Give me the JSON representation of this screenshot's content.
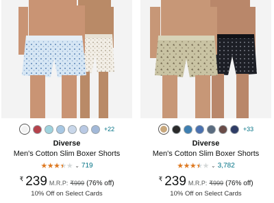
{
  "products": [
    {
      "swatch_colors": [
        "#f2f2f2",
        "#b5434c",
        "#9fd3de",
        "#a7c7e3",
        "#c9d7ea",
        "#b9c9e4",
        "#a2b8d8"
      ],
      "more_colors": "+22",
      "brand": "Diverse",
      "title": "Men's Cotton Slim Boxer Shorts",
      "rating_count": "719",
      "currency": "₹",
      "price": "239",
      "mrp_label": "M.R.P:",
      "mrp": "₹999",
      "discount": "(76% off)",
      "offer": "10% Off on Select Cards"
    },
    {
      "swatch_colors": [
        "#c8a77c",
        "#2a2a2a",
        "#3e7fb1",
        "#4a71b0",
        "#5a6c80",
        "#6a4c48",
        "#2f3c66"
      ],
      "more_colors": "+33",
      "brand": "Diverse",
      "title": "Men's Cotton Slim Boxer Shorts",
      "rating_count": "3,782",
      "currency": "₹",
      "price": "239",
      "mrp_label": "M.R.P:",
      "mrp": "₹999",
      "discount": "(76% off)",
      "offer": "10% Off on Select Cards"
    }
  ],
  "rating_stars": "3.5 of 5"
}
